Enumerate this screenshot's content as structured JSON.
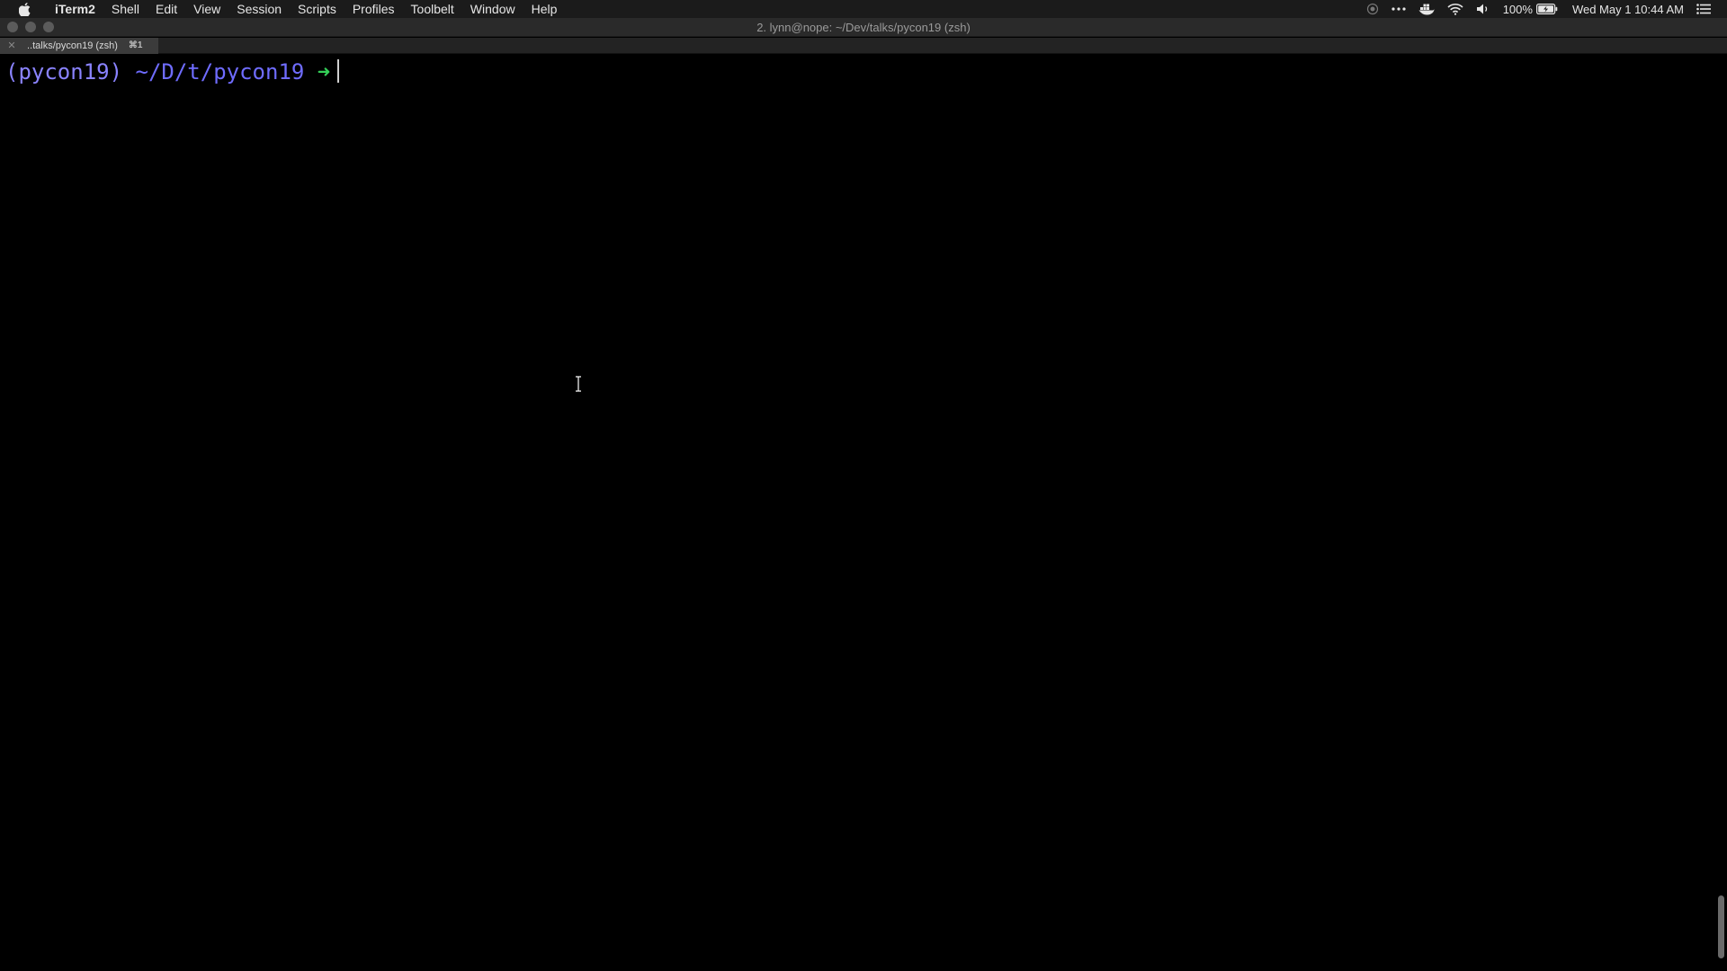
{
  "menubar": {
    "app_name": "iTerm2",
    "items": [
      "Shell",
      "Edit",
      "View",
      "Session",
      "Scripts",
      "Profiles",
      "Toolbelt",
      "Window",
      "Help"
    ],
    "battery_text": "100%",
    "clock_text": "Wed May 1  10:44 AM",
    "status_icons": [
      "record-icon",
      "more-icon",
      "docker-icon",
      "wifi-icon",
      "volume-icon",
      "battery-icon",
      "notification-center-icon"
    ]
  },
  "window": {
    "title": "2. lynn@nope: ~/Dev/talks/pycon19 (zsh)"
  },
  "tab": {
    "label": "..talks/pycon19 (zsh)",
    "shortcut": "⌘1"
  },
  "terminal": {
    "venv": "(pycon19)",
    "path": "~/D/t/pycon19",
    "arrow": "➜"
  },
  "colors": {
    "background": "#000000",
    "venv": "#8a83ff",
    "path": "#6f6cff",
    "arrow": "#34d058"
  }
}
